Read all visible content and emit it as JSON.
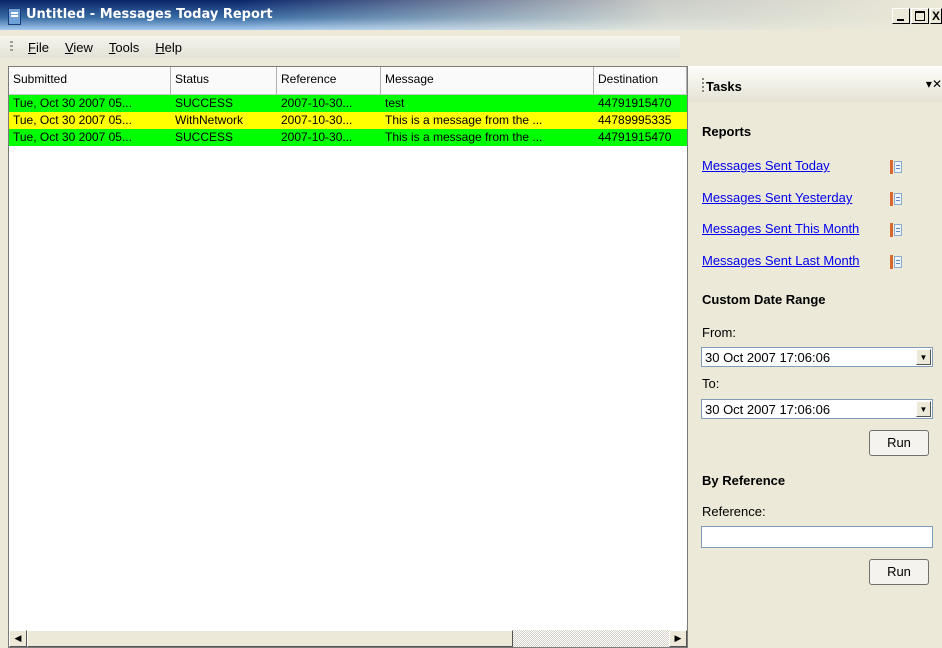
{
  "window": {
    "title": "Untitled - Messages Today Report",
    "controls": {
      "minimize": "_",
      "maximize": "□",
      "close": "X"
    }
  },
  "menu": {
    "items": [
      {
        "label": "File",
        "mnemonic": "F",
        "rest": "ile"
      },
      {
        "label": "View",
        "mnemonic": "V",
        "rest": "iew"
      },
      {
        "label": "Tools",
        "mnemonic": "T",
        "rest": "ools"
      },
      {
        "label": "Help",
        "mnemonic": "H",
        "rest": "elp"
      }
    ]
  },
  "grid": {
    "columns": [
      "Submitted",
      "Status",
      "Reference",
      "Message",
      "Destination"
    ],
    "rows": [
      {
        "submitted": "Tue, Oct 30 2007 05...",
        "status": "SUCCESS",
        "reference": "2007-10-30...",
        "message": "test",
        "destination": "44791915470",
        "color": "#00ff00"
      },
      {
        "submitted": "Tue, Oct 30 2007 05...",
        "status": "WithNetwork",
        "reference": "2007-10-30...",
        "message": "This is a message from the ...",
        "destination": "44789995335",
        "color": "#ffff00"
      },
      {
        "submitted": "Tue, Oct 30 2007 05...",
        "status": "SUCCESS",
        "reference": "2007-10-30...",
        "message": "This is a message from the ...",
        "destination": "44791915470",
        "color": "#00ff00"
      }
    ]
  },
  "tasks": {
    "title": "Tasks",
    "header_controls": "▾✕",
    "reports_heading": "Reports",
    "reports": [
      "Messages Sent Today",
      "Messages Sent Yesterday",
      "Messages Sent This Month",
      "Messages Sent Last Month"
    ],
    "custom_range_heading": "Custom Date Range",
    "from_label": "From:",
    "from_value": "30 Oct  2007 17:06:06",
    "to_label": "To:",
    "to_value": "30 Oct  2007 17:06:06",
    "run_label": "Run",
    "by_reference_heading": "By Reference",
    "reference_label": "Reference:",
    "reference_value": "",
    "run2_label": "Run"
  },
  "colors": {
    "success": "#00ff00",
    "with_network": "#ffff00",
    "link": "#0000ee"
  }
}
